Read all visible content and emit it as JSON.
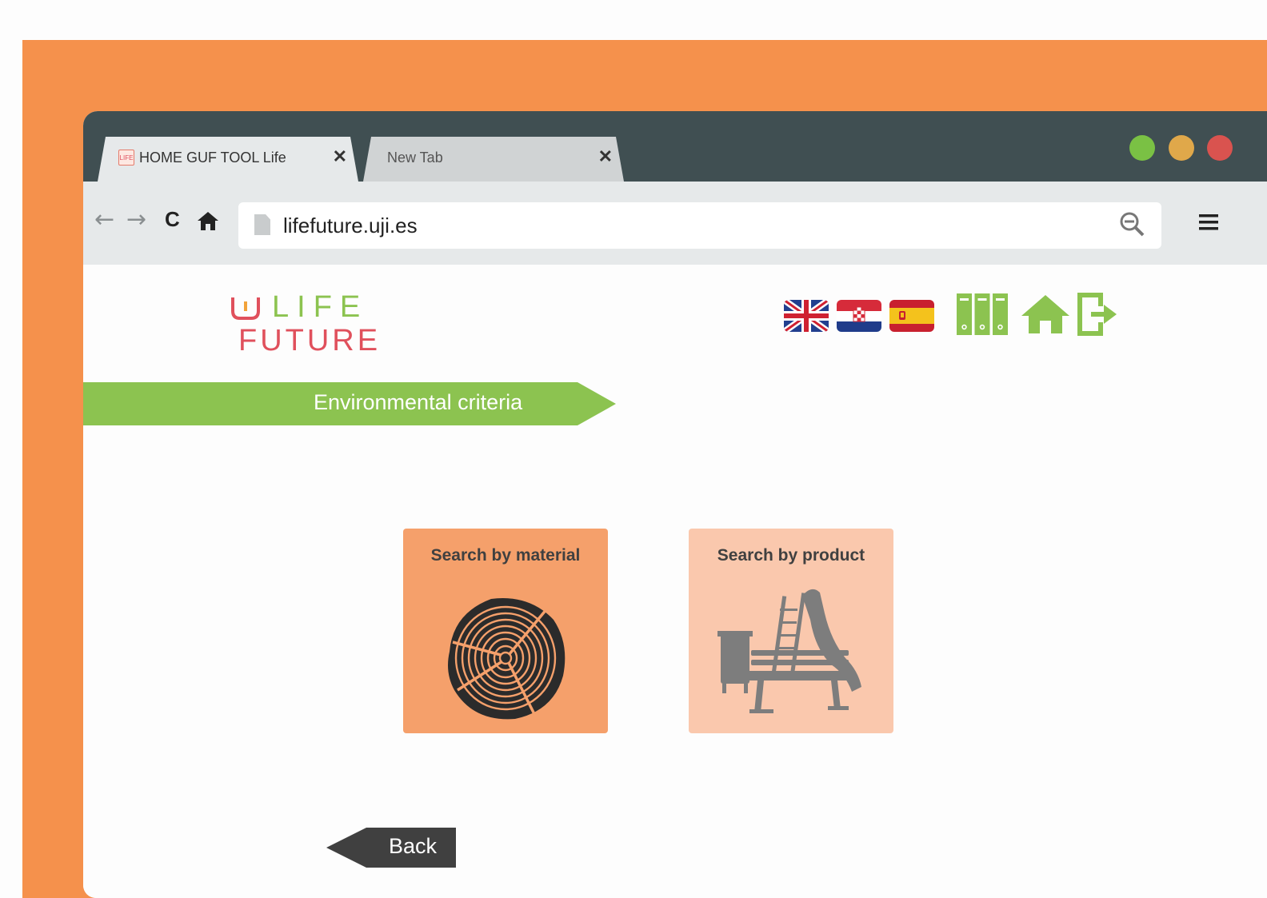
{
  "browser": {
    "tabs": [
      {
        "label": "HOME GUF TOOL Life",
        "close": "✕",
        "favicon": "LIFE"
      },
      {
        "label": "New Tab",
        "close": "✕"
      }
    ],
    "nav": {
      "back": "←",
      "forward": "→",
      "reload": "C",
      "home": "🏠"
    },
    "address": "lifefuture.uji.es"
  },
  "logo": {
    "line1": "LIFE",
    "line2": "FUTURE"
  },
  "header_icons": [
    "uk-flag-icon",
    "croatia-flag-icon",
    "spain-flag-icon",
    "binders-icon",
    "home-icon",
    "logout-icon"
  ],
  "banner": {
    "title": "Environmental criteria"
  },
  "cards": [
    {
      "label": "Search by material",
      "icon": "tree-rings-icon"
    },
    {
      "label": "Search by product",
      "icon": "playground-furniture-icon"
    }
  ],
  "back_label": "Back",
  "colors": {
    "frame": "#f5914c",
    "chrome": "#404f52",
    "green": "#8cc350",
    "red": "#e0505c",
    "card_material": "#f5a06b",
    "card_product": "#fac8ad",
    "dark": "#404040"
  }
}
